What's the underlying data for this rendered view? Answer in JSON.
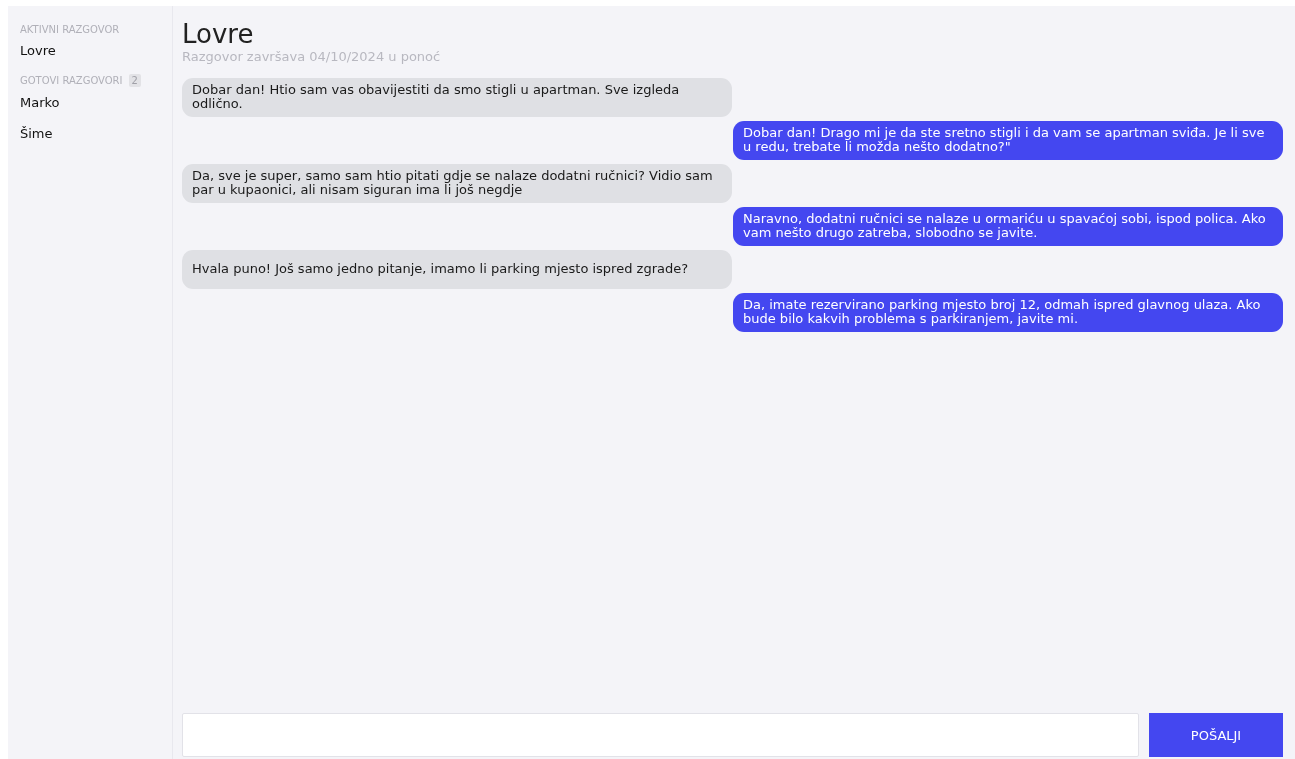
{
  "sidebar": {
    "sections": [
      {
        "label": "AKTIVNI RAZGOVOR",
        "items": [
          {
            "label": "Lovre"
          }
        ]
      },
      {
        "label": "GOTOVI RAZGOVORI",
        "count": "2",
        "items": [
          {
            "label": "Marko"
          },
          {
            "label": "Šime"
          }
        ]
      }
    ]
  },
  "chat": {
    "title": "Lovre",
    "subtitle": "Razgovor završava 04/10/2024 u ponoć",
    "messages": [
      {
        "kind": "received",
        "text": "Dobar dan! Htio sam vas obavijestiti da smo stigli u apartman. Sve izgleda odlično."
      },
      {
        "kind": "sent",
        "text": "Dobar dan! Drago mi je da ste sretno stigli i da vam se apartman sviđa. Je li sve u redu, trebate li možda nešto dodatno?\""
      },
      {
        "kind": "received",
        "text": "Da, sve je super, samo sam htio pitati gdje se nalaze dodatni ručnici? Vidio sam par u kupaonici, ali nisam siguran ima li još negdje"
      },
      {
        "kind": "sent",
        "text": "Naravno, dodatni ručnici se nalaze u ormariću u spavaćoj sobi, ispod polica. Ako vam nešto drugo zatreba, slobodno se javite."
      },
      {
        "kind": "received",
        "text": "Hvala puno! Još samo jedno pitanje, imamo li parking mjesto ispred zgrade?"
      },
      {
        "kind": "sent",
        "text": "Da, imate rezervirano parking mjesto broj 12, odmah ispred glavnog ulaza. Ako bude bilo kakvih problema s parkiranjem, javite mi."
      }
    ],
    "send_button": "POŠALJI"
  }
}
